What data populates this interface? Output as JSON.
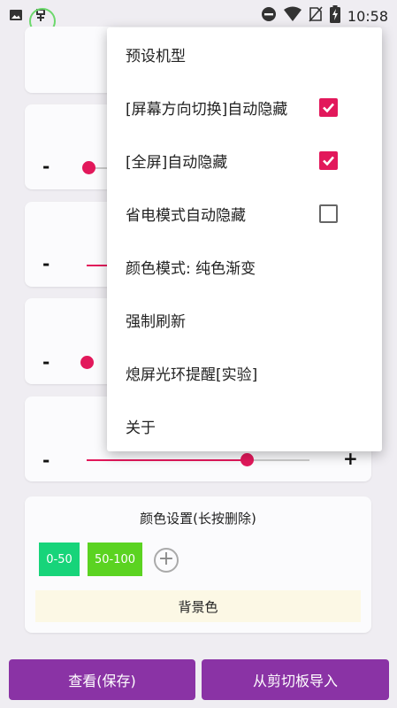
{
  "status_bar": {
    "time": "10:58",
    "left_icons": [
      "image-icon",
      "bug-icon"
    ],
    "right_icons": [
      "dnd-icon",
      "wifi-icon",
      "no-sim-icon",
      "battery-charging-icon"
    ]
  },
  "sliders": [
    {
      "minus": "-",
      "plus": "+",
      "level": 0.0
    },
    {
      "minus": "-",
      "plus": "+",
      "level": 0.0
    },
    {
      "minus": "-",
      "plus": "+",
      "level": 0.0
    },
    {
      "minus": "-",
      "plus": "+",
      "level": 0.72
    }
  ],
  "color_settings": {
    "title": "颜色设置(长按删除)",
    "chips": [
      {
        "label": "0-50",
        "color": "#17d47a"
      },
      {
        "label": "50-100",
        "color": "#5bd321"
      }
    ],
    "add_symbol": "+",
    "background_button": "背景色"
  },
  "bottom": {
    "view_save": "查看(保存)",
    "import_clipboard": "从剪切板导入"
  },
  "menu": {
    "items": [
      {
        "label": "预设机型"
      },
      {
        "label": "[屏幕方向切换]自动隐藏",
        "checked": true
      },
      {
        "label": "[全屏]自动隐藏",
        "checked": true
      },
      {
        "label": "省电模式自动隐藏",
        "checked": false
      },
      {
        "label": "颜色模式: 纯色渐变"
      },
      {
        "label": "强制刷新"
      },
      {
        "label": "熄屏光环提醒[实验]"
      },
      {
        "label": "关于"
      }
    ]
  },
  "colors": {
    "accent": "#e2185b",
    "button_purple": "#8a33a5",
    "background": "#efedf2"
  }
}
